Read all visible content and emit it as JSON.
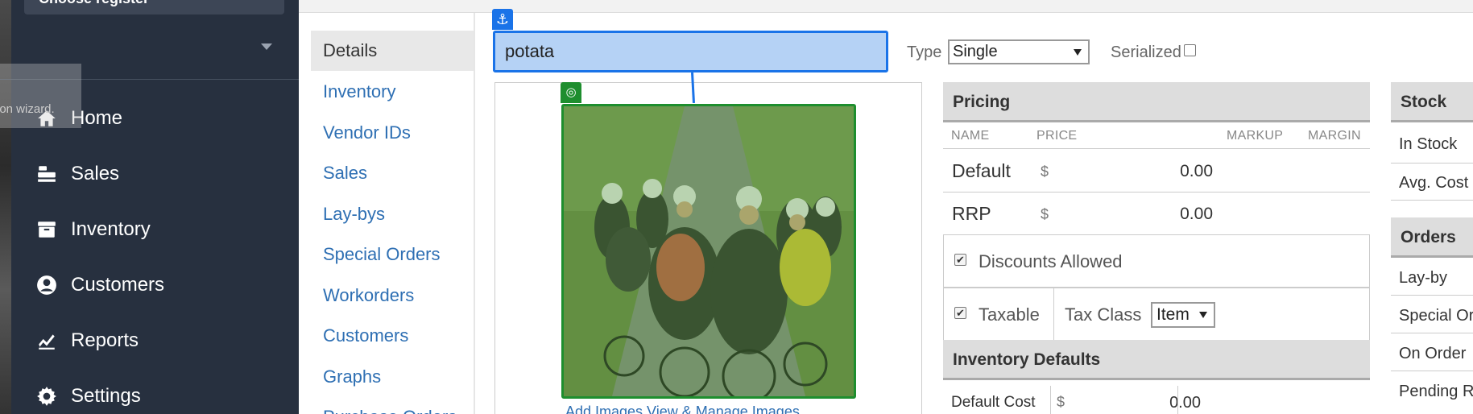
{
  "sidebar": {
    "register_label": "Choose register",
    "wizard_tip": "ion wizard.",
    "items": [
      {
        "label": "Home",
        "icon": "home-icon"
      },
      {
        "label": "Sales",
        "icon": "register-icon"
      },
      {
        "label": "Inventory",
        "icon": "box-icon"
      },
      {
        "label": "Customers",
        "icon": "user-icon"
      },
      {
        "label": "Reports",
        "icon": "chart-icon"
      },
      {
        "label": "Settings",
        "icon": "gear-icon"
      }
    ]
  },
  "subnav": {
    "selected": "Details",
    "links": [
      "Inventory",
      "Vendor IDs",
      "Sales",
      "Lay-bys",
      "Special Orders",
      "Workorders",
      "Customers",
      "Graphs",
      "Purchase Orders"
    ]
  },
  "item": {
    "name_value": "potata",
    "anchor_icon": "anchor-icon",
    "target_icon": "target-icon",
    "photo_links": "Add Images   View & Manage Images"
  },
  "type": {
    "label": "Type",
    "value": "Single",
    "serialized_label": "Serialized",
    "serialized_checked": false
  },
  "pricing": {
    "title": "Pricing",
    "columns": {
      "name": "NAME",
      "price": "PRICE",
      "markup": "MARKUP",
      "margin": "MARGIN"
    },
    "rows": [
      {
        "name": "Default",
        "currency": "$",
        "value": "0.00"
      },
      {
        "name": "RRP",
        "currency": "$",
        "value": "0.00"
      }
    ],
    "discounts_label": "Discounts Allowed",
    "discounts_checked": true,
    "taxable_label": "Taxable",
    "taxable_checked": true,
    "tax_class_label": "Tax Class",
    "tax_class_value": "Item"
  },
  "inventory_defaults": {
    "title": "Inventory Defaults",
    "default_cost_label": "Default Cost",
    "currency": "$",
    "default_cost_value": "0.00"
  },
  "stock": {
    "title": "Stock",
    "items": [
      "In Stock",
      "Avg. Cost"
    ]
  },
  "orders": {
    "title": "Orders",
    "items": [
      "Lay-by",
      "Special Or",
      "On Order",
      "Pending R"
    ]
  },
  "colors": {
    "sidebar_bg": "#27303f",
    "link": "#2e6fb3",
    "selection_blue": "#1a73e8",
    "target_green": "#1e8e2e"
  }
}
